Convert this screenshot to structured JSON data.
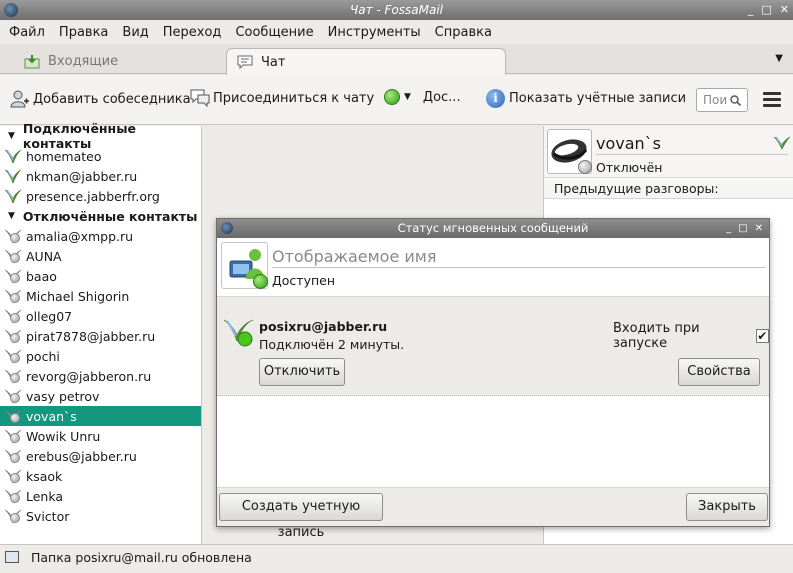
{
  "window": {
    "title": "Чат - FossaMail",
    "controls": [
      "_",
      "□",
      "✕"
    ]
  },
  "menu": [
    "Файл",
    "Правка",
    "Вид",
    "Переход",
    "Сообщение",
    "Инструменты",
    "Справка"
  ],
  "tabs": [
    {
      "label": "Входящие",
      "icon": "inbox-icon"
    },
    {
      "label": "Чат",
      "icon": "chat-bubble-icon"
    }
  ],
  "toolbar": {
    "add_contact": "Добавить собеседника",
    "join_chat": "Присоединиться к чату",
    "status_short": "Дос...",
    "show_accounts": "Показать учётные записи",
    "search_placeholder": "Пои"
  },
  "contacts": {
    "online_group": "Подключённые контакты",
    "online": [
      "homemateo",
      "nkman@jabber.ru",
      "presence.jabberfr.org"
    ],
    "offline_group": "Отключённые контакты",
    "offline": [
      "amalia@xmpp.ru",
      "AUNA",
      "baao",
      "Michael Shigorin",
      "olleg07",
      "pirat7878@jabber.ru",
      "pochi",
      "revorg@jabberon.ru",
      "vasy petrov",
      "vovan`s",
      "Wowik Unru",
      "erebus@jabber.ru",
      "ksaok",
      "Lenka",
      "Svictor"
    ],
    "selected": "vovan`s"
  },
  "conversation": {
    "name": "vovan`s",
    "status": "Отключён",
    "previous": "Предыдущие разговоры:"
  },
  "dialog": {
    "title": "Статус мгновенных сообщений",
    "controls": [
      "_",
      "□",
      "✕"
    ],
    "display_name_placeholder": "Отображаемое имя",
    "status": "Доступен",
    "account": {
      "name": "posixru@jabber.ru",
      "connected": "Подключён 2 минуты.",
      "startup_label": "Входить при запуске",
      "startup_checked": "✔",
      "disconnect": "Отключить",
      "properties": "Свойства"
    },
    "create_account": "Создать учетную запись",
    "close": "Закрыть"
  },
  "statusbar": {
    "text": "Папка posixru@mail.ru обновлена"
  },
  "colors": {
    "selection": "#14977f",
    "online": "#3fb51f"
  }
}
